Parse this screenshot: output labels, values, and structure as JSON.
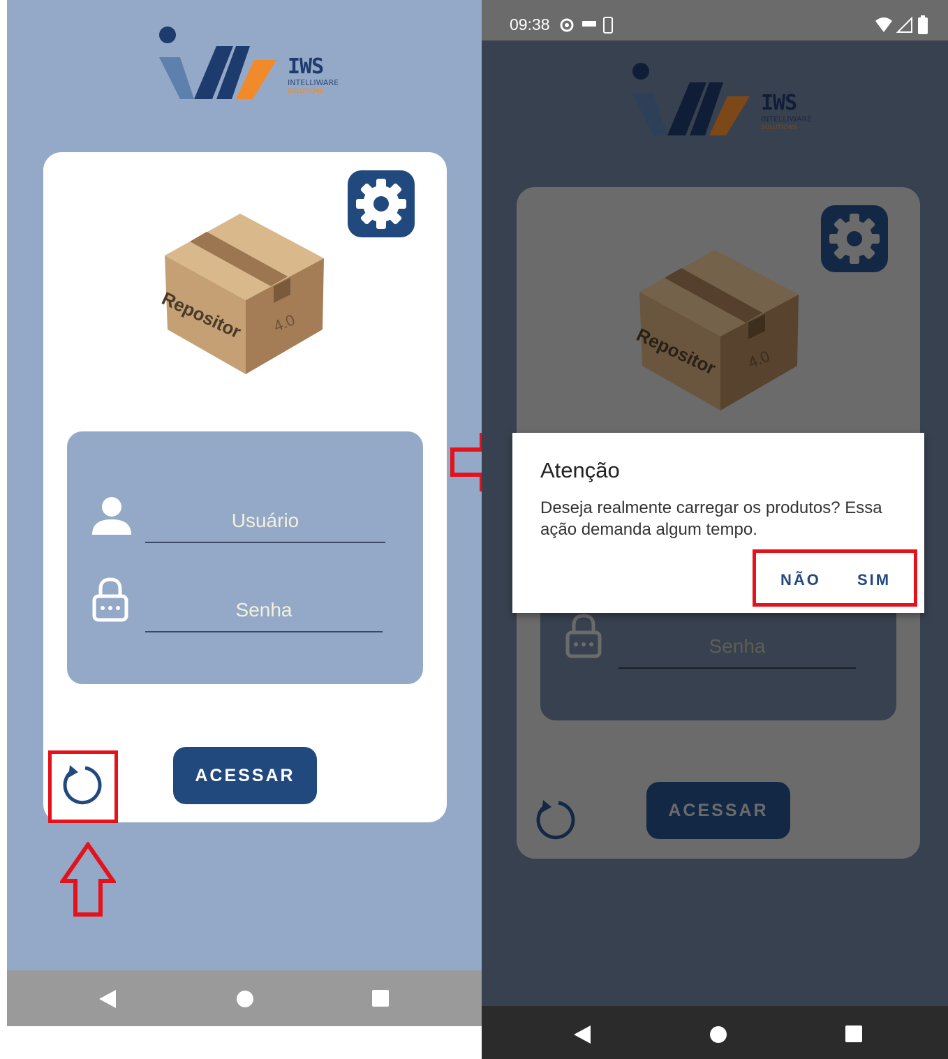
{
  "left_screen": {
    "logo": {
      "text": "IWS",
      "subtitle": "INTELLIWARE",
      "tagline": "SOLUTIONS"
    },
    "box_label": "Repositor",
    "box_version": "4.0",
    "username_placeholder": "Usuário",
    "password_placeholder": "Senha",
    "access_button": "ACESSAR"
  },
  "right_screen": {
    "status_time": "09:38",
    "logo": {
      "text": "IWS",
      "subtitle": "INTELLIWARE",
      "tagline": "SOLUTIONS"
    },
    "box_label": "Repositor",
    "box_version": "4.0",
    "password_placeholder": "Senha",
    "access_button": "ACESSAR",
    "dialog": {
      "title": "Atenção",
      "message": "Deseja realmente carregar os produtos? Essa ação demanda algum tempo.",
      "no_button": "NÃO",
      "yes_button": "SIM"
    }
  },
  "colors": {
    "primary": "#21497e",
    "page_background": "#94a9c8",
    "highlight": "#e3121b",
    "overlay": "#38414f"
  },
  "icons": [
    "gear-icon",
    "user-icon",
    "lock-icon",
    "refresh-icon",
    "back-icon",
    "home-icon",
    "recents-icon",
    "arrow-up-icon",
    "arrow-right-icon",
    "wifi-icon",
    "signal-icon",
    "battery-icon"
  ]
}
